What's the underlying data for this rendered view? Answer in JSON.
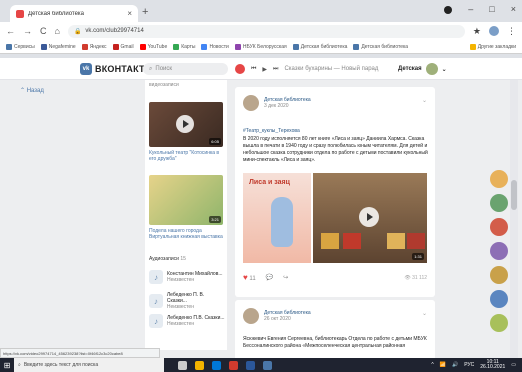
{
  "browser": {
    "tab_title": "Детская библиотека",
    "tab_close": "×",
    "new_tab": "+",
    "address": "vk.com/club29974714",
    "nav": {
      "back": "←",
      "forward": "→",
      "reload": "C",
      "home": "⌂"
    },
    "window_controls": {
      "minimize": "–",
      "maximize": "□",
      "close": "×"
    },
    "bookmarks": [
      "Сервисы",
      "Negafemine",
      "Яндекс",
      "Gmail",
      "YouTube",
      "Карты",
      "Новости",
      "НБУК Белорусская",
      "Детская библиотека",
      "Детская библиотека"
    ],
    "bookmarks_other": "Другие закладки",
    "colors": {
      "accent": "#4a76a8"
    }
  },
  "vk": {
    "logo_text": "ВКОНТАКТЕ",
    "logo_mark": "vk",
    "search_placeholder": "Поиск",
    "now_playing": "Сказки бухарины — Новый парад",
    "user_name": "Детская",
    "left_nav": "Назад",
    "midcol": {
      "header": "видеозаписи",
      "video1_duration": "6:05",
      "video1_label": "Кукольный театр \"Котосинка в его дружба\"",
      "video2_duration": "3:21",
      "video2_label": "Подела нашего города Виртуальная книжная выставка",
      "audio_header": "Аудиозаписи",
      "audio_count": "15",
      "audios": [
        {
          "title": "Константин Михайлов...",
          "artist": "Неизвестен"
        },
        {
          "title": "Лебеденко П. В. Сказки...",
          "artist": "Неизвестен"
        },
        {
          "title": "Лебеденко П.В. Сказки...",
          "artist": "Неизвестен"
        }
      ]
    },
    "post1": {
      "author": "Детская библиотека",
      "date": "3 дек 2020",
      "tags": "#Театр_куклы_Терехова",
      "text": "В 2020 году исполняется 80 лет книге «Лиса и заяц» Даниила Хармса. Сказка вышла в печати в 1940 году и сразу полюбилась юным читателям. Для детей и небольшое сказка сотрудники отдела по работе с детьми поставили кукольный мини-спектакль «Лиса и заяц».",
      "image1_title": "Лиса и заяц",
      "video_duration": "1:31",
      "likes": "11",
      "views": "31 112"
    },
    "post2": {
      "author": "Детская библиотека",
      "date": "26 окт 2020",
      "text": "Ясюкевич Евгения Сергеевна, библиотекарь Отдела по работе с детьми МБУК Бессоналинского района «Межпоселенческая центральная районная"
    }
  },
  "statusbar_url": "https://vk.com/video29974714_456239238?list=0f46f12c3c20cabe8",
  "taskbar": {
    "search_placeholder": "Введите здесь текст для поиска",
    "lang": "РУС",
    "time": "10:11",
    "date": "26.10.2021"
  }
}
